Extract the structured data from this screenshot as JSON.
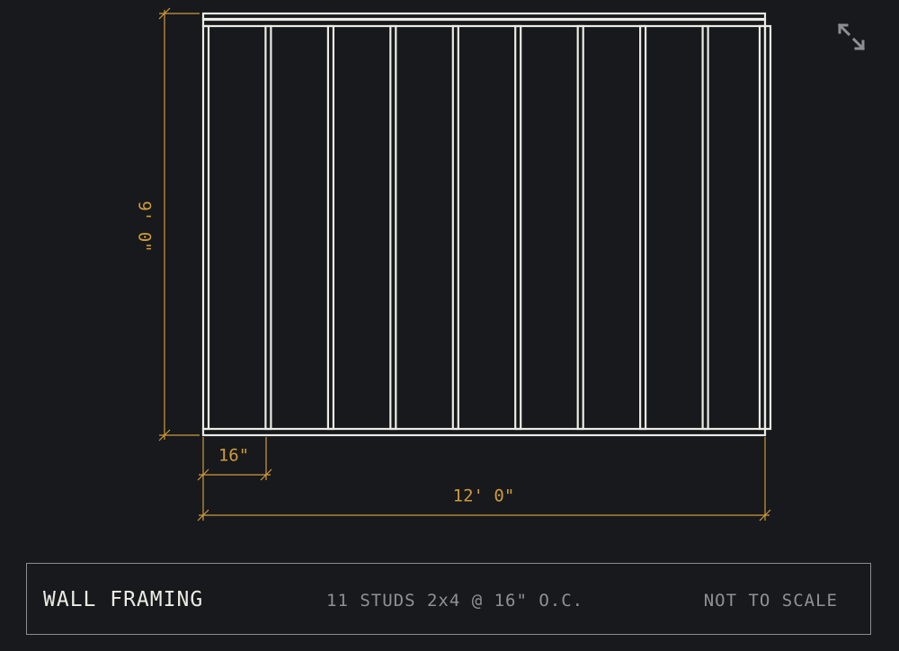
{
  "dimensions": {
    "height_label": "9' 0\"",
    "spacing_label": "16\"",
    "width_label": "12' 0\""
  },
  "title_block": {
    "title": "WALL FRAMING",
    "spec": "11 STUDS 2x4 @ 16\" O.C.",
    "scale_note": "NOT TO SCALE"
  },
  "framing": {
    "stud_count": 11,
    "stud_spacing_in": 16,
    "wall_width_in": 144,
    "wall_height_in": 108
  },
  "colors": {
    "background": "#17191c",
    "framing": "#ecebe4",
    "dimension": "#cf9a3c",
    "muted": "#8f9194"
  },
  "icons": {
    "expand": "expand-icon"
  }
}
